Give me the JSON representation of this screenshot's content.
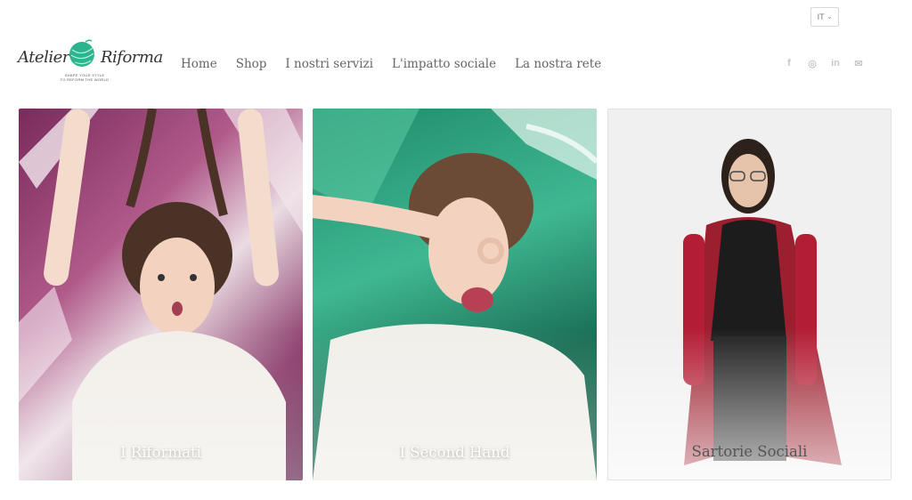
{
  "header": {
    "language": "IT",
    "logo": {
      "text_left": "Atelier",
      "text_right": "Riforma",
      "tagline_1": "SHAPE YOUR STYLE",
      "tagline_2": "TO REFORM THE WORLD"
    },
    "nav": [
      "Home",
      "Shop",
      "I nostri servizi",
      "L'impatto sociale",
      "La nostra rete"
    ],
    "social": [
      {
        "icon": "facebook-icon",
        "glyph": "f"
      },
      {
        "icon": "instagram-icon",
        "glyph": "◎"
      },
      {
        "icon": "linkedin-icon",
        "glyph": "in"
      },
      {
        "icon": "email-icon",
        "glyph": "✉"
      }
    ]
  },
  "cards": [
    {
      "label": "I Riformati"
    },
    {
      "label": "I Second Hand"
    },
    {
      "label": "Sartorie Sociali"
    }
  ],
  "colors": {
    "brand_green": "#2bb58e",
    "nav_text": "#666666",
    "icon_gray": "#c7c7c7"
  }
}
